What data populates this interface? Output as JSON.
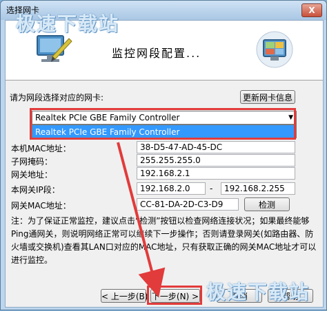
{
  "window": {
    "title": "选择网卡",
    "close_label": "X"
  },
  "header": {
    "title": "监控网段配置..."
  },
  "watermark": {
    "text": "极速下载站"
  },
  "adapter": {
    "prompt": "请为网段选择对应的网卡:",
    "refresh_label": "更新网卡信息",
    "selected": "Realtek PCIe GBE Family Controller",
    "dropdown_option": "Realtek PCIe GBE Family Controller"
  },
  "fields": {
    "mac_label": "本机MAC地址：",
    "mac_value": "38-D5-47-AD-45-DC",
    "mask_label": "子网掩码：",
    "mask_value": "255.255.255.0",
    "gateway_label": "网关地址：",
    "gateway_value": "192.168.2.1",
    "ip_range_label": "本网关IP段：",
    "ip_start": "192.168.2.0",
    "ip_sep": "-",
    "ip_end": "192.168.2.255",
    "gw_mac_label": "网关MAC地址：",
    "gw_mac_value": "CC-81-DA-2D-C3-D9",
    "detect_label": "检测"
  },
  "note": {
    "text": "注：为了保证正常监控，建议点击“检测”按钮以检查网络连接状况；如果最终能够Ping通网关，则说明网络正常可以继续下一步操作；否则请登录网关(如路由器、防火墙或交换机)查看其LAN口对应的MAC地址，只有获取正确的网关MAC地址才可以进行监控。"
  },
  "footer": {
    "prev_label": "< 上一步(B)",
    "next_label": "下一步(N) >",
    "cancel_label": "取消",
    "help_label": "帮助"
  },
  "colors": {
    "highlight": "#3399ff",
    "annotation": "#e23b3b"
  }
}
